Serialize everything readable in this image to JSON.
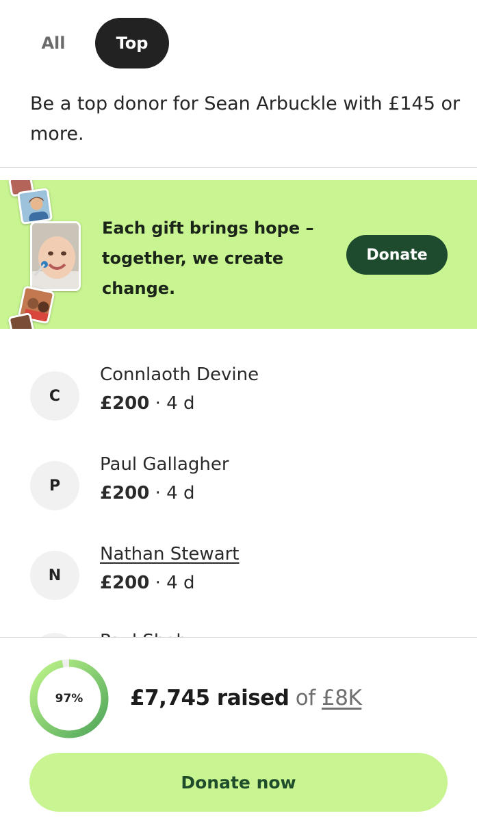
{
  "tabs": [
    {
      "label": "All",
      "active": false
    },
    {
      "label": "Top",
      "active": true
    }
  ],
  "intro": "Be a top donor for Sean Arbuckle with £145 or more.",
  "promo": {
    "message": "Each gift brings hope – together, we create change.",
    "button_label": "Donate",
    "background": "#c8f491",
    "button_color": "#1e4a2e"
  },
  "donors": [
    {
      "initial": "C",
      "name": "Connlaoth Devine",
      "amount": "£200",
      "separator": "·",
      "time": "4 d"
    },
    {
      "initial": "P",
      "name": "Paul Gallagher",
      "amount": "£200",
      "separator": "·",
      "time": "4 d"
    },
    {
      "initial": "N",
      "name": "Nathan Stewart",
      "amount": "£200",
      "separator": "·",
      "time": "4 d"
    },
    {
      "initial": "",
      "name": "Paul Shab"
    }
  ],
  "progress": {
    "percent_label": "97%",
    "percent": 97,
    "raised": "£7,745 raised",
    "of": "of",
    "target": "£8K"
  },
  "cta": {
    "label": "Donate now"
  },
  "colors": {
    "accent": "#c8f491",
    "ring_start": "#4fa65a",
    "ring_end": "#bff58a",
    "dark_green": "#1f4d2c"
  }
}
